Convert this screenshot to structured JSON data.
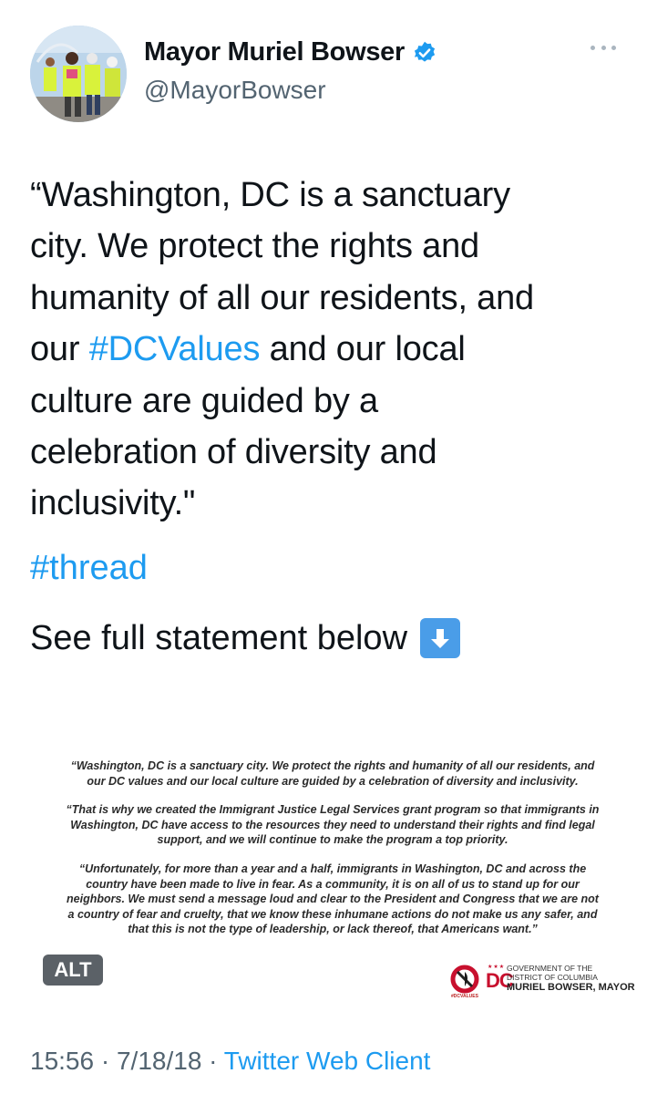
{
  "author": {
    "display_name": "Mayor Muriel Bowser",
    "handle": "@MayorBowser",
    "verified_icon": "verified-badge-icon",
    "more_icon": "more-options-icon"
  },
  "tweet": {
    "lines": [
      "“Washington, DC is a sanctuary",
      "city. We protect the rights and",
      "humanity of all our residents, and"
    ],
    "line4_pre": "our ",
    "line4_hashtag": "#DCValues",
    "line4_post": " and our local",
    "lines_after": [
      "culture are guided by a",
      "celebration of diversity and",
      "inclusivity.\""
    ],
    "thread_tag": "#thread",
    "see_full": "See full statement below",
    "down_arrow_icon": "down-arrow-emoji-icon"
  },
  "media": {
    "paragraphs": [
      "“Washington, DC is a sanctuary city. We protect the rights and humanity of all our residents, and our DC values and our local culture are guided by a celebration of diversity and inclusivity.",
      "“That is why we created the Immigrant Justice Legal Services grant program so that immigrants in Washington, DC have access to the resources they need to understand their rights and find legal support, and we will continue to make the program a top priority.",
      "“Unfortunately, for more than a year and a half, immigrants in Washington, DC and across the country have been made to live in fear. As a community, it is on all of us to stand up for our neighbors. We must send a message loud and clear to the President and Congress that we are not a country of fear and cruelty, that we know these inhumane actions do not make us any safer, and that this is not the type of leadership, or lack thereof, that Americans want.”"
    ],
    "alt_label": "ALT",
    "dcvalues_small": "#DCVALUES",
    "gov_dc": "DC",
    "gov_line1": "GOVERNMENT OF THE",
    "gov_line2": "DISTRICT OF COLUMBIA",
    "gov_mayor": "MURIEL BOWSER, MAYOR"
  },
  "meta": {
    "time": "15:56",
    "sep1": " · ",
    "date": "7/18/18",
    "sep2": " · ",
    "source": "Twitter Web Client"
  },
  "colors": {
    "link": "#1d9bf0",
    "secondary_text": "#536471",
    "verified": "#1d9bf0"
  }
}
